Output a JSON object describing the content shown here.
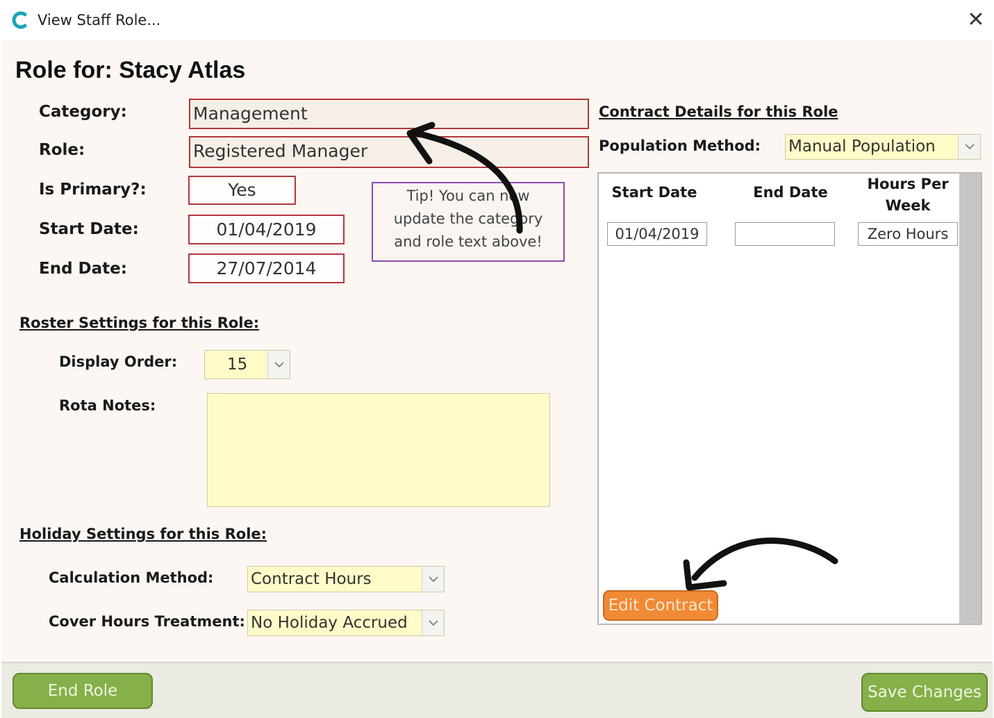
{
  "window": {
    "title": "View Staff Role...",
    "close_symbol": "✕"
  },
  "form": {
    "heading": "Role for:  Stacy Atlas",
    "fields": {
      "category_label": "Category:",
      "category_value": "Management",
      "role_label": "Role:",
      "role_value": "Registered Manager",
      "is_primary_label": "Is Primary?:",
      "is_primary_value": "Yes",
      "start_date_label": "Start Date:",
      "start_date_value": "01/04/2019",
      "end_date_label": "End Date:",
      "end_date_value": "27/07/2014"
    },
    "tip": {
      "line1": "Tip!  You can now",
      "line2": "update the category",
      "line3": "and role text above!"
    },
    "roster": {
      "section_label": "Roster Settings for this Role:",
      "display_order_label": "Display Order:",
      "display_order_value": "15",
      "rota_notes_label": "Rota Notes:",
      "rota_notes_value": ""
    },
    "holiday": {
      "section_label": "Holiday Settings for this Role:",
      "calc_method_label": "Calculation Method:",
      "calc_method_value": "Contract Hours",
      "cover_hours_label": "Cover Hours Treatment:",
      "cover_hours_value": "No Holiday Accrued"
    },
    "contract": {
      "section_label": "Contract Details for this Role",
      "population_method_label": "Population Method:",
      "population_method_value": "Manual Population",
      "columns": {
        "start": "Start Date",
        "end": "End Date",
        "hours_line1": "Hours Per",
        "hours_line2": "Week"
      },
      "row": {
        "start": "01/04/2019",
        "end": "",
        "hours": "Zero Hours"
      },
      "edit_button": "Edit Contract"
    }
  },
  "footer": {
    "end_role_button": "End Role",
    "save_button": "Save Changes"
  },
  "colors": {
    "accent_red_border": "#b3373a",
    "tip_border": "#8b4bb3",
    "combo_yellow": "#fffbc8",
    "orange_button": "#f08a34",
    "green_button": "#86b049",
    "app_icon": "#1aa3b8"
  },
  "icons": [
    "app-logo-icon",
    "close-icon",
    "chevron-down-icon",
    "arrow-annotation-icon"
  ]
}
